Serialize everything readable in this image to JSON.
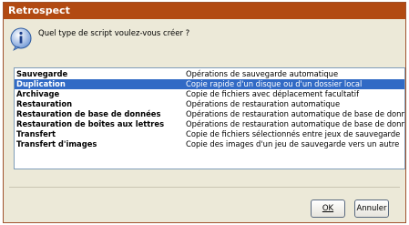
{
  "window": {
    "title": "Retrospect"
  },
  "prompt": {
    "text": "Quel type de script voulez-vous créer ?",
    "icon": "info-icon"
  },
  "script_types": [
    {
      "name": "Sauvegarde",
      "description": "Opérations de sauvegarde automatique"
    },
    {
      "name": "Duplication",
      "description": "Copie rapide d'un disque ou d'un dossier local",
      "selected": true
    },
    {
      "name": "Archivage",
      "description": "Copie de fichiers avec déplacement facultatif"
    },
    {
      "name": "Restauration",
      "description": "Opérations de restauration automatique"
    },
    {
      "name": "Restauration de base de données",
      "description": "Opérations de restauration automatique de base de données"
    },
    {
      "name": "Restauration de boîtes aux lettres",
      "description": "Opérations de restauration automatique de base de données"
    },
    {
      "name": "Transfert",
      "description": "Copie de fichiers sélectionnés entre jeux de sauvegarde"
    },
    {
      "name": "Transfert d'images",
      "description": "Copie des images d'un jeu de sauvegarde vers un autre"
    }
  ],
  "buttons": {
    "ok": "OK",
    "cancel": "Annuler"
  },
  "colors": {
    "titlebar": "#b24a12",
    "selection": "#316ac5",
    "dialog_bg": "#ece9d8"
  }
}
